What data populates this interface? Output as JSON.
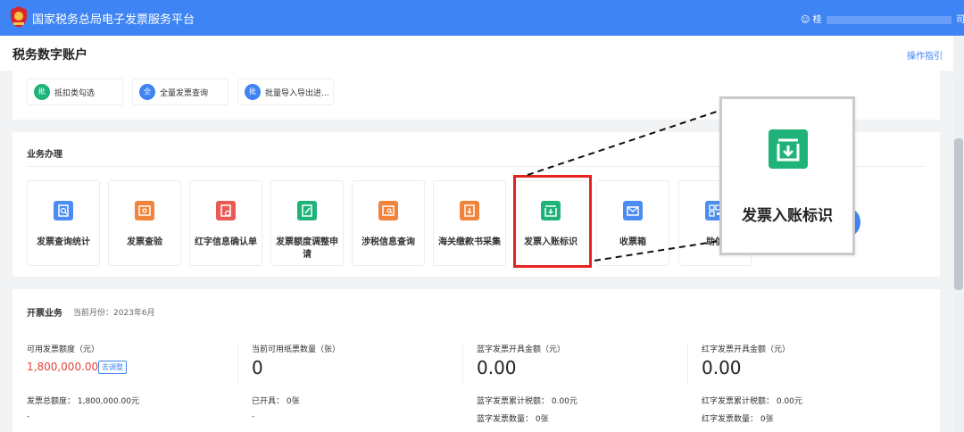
{
  "header": {
    "site_title": "国家税务总局电子发票服务平台",
    "user_prefix": "桂",
    "user_suffix": "司"
  },
  "subheader": {
    "page_title": "税务数字账户",
    "guide_link": "操作指引"
  },
  "quick_actions": [
    {
      "badge": "批",
      "label": "抵扣类勾选",
      "color": "#1fb37a"
    },
    {
      "badge": "全",
      "label": "全量发票查询",
      "color": "#3e84f4"
    },
    {
      "badge": "批",
      "label": "批量导入导出进...",
      "color": "#3e84f4"
    }
  ],
  "business": {
    "title": "业务办理",
    "tiles": [
      {
        "label": "发票查询统计",
        "icon": "invoice-search-icon",
        "color": "#4a8cf0"
      },
      {
        "label": "发票查验",
        "icon": "invoice-verify-icon",
        "color": "#f0843c"
      },
      {
        "label": "红字信息确认单",
        "icon": "red-letter-confirm-icon",
        "color": "#e85b55"
      },
      {
        "label": "发票额度调整申请",
        "icon": "quota-adjust-icon",
        "color": "#1fb37a"
      },
      {
        "label": "涉税信息查询",
        "icon": "tax-info-search-icon",
        "color": "#f0843c"
      },
      {
        "label": "海关缴款书采集",
        "icon": "customs-collect-icon",
        "color": "#f0843c"
      },
      {
        "label": "发票入账标识",
        "icon": "invoice-accounting-icon",
        "color": "#1fb37a"
      },
      {
        "label": "收票箱",
        "icon": "mailbox-icon",
        "color": "#4a8cf0"
      },
      {
        "label": "助信",
        "icon": "qr-code-icon",
        "color": "#4a8cf0"
      }
    ],
    "zoom_label": "发票入账标识"
  },
  "invoicing": {
    "title": "开票业务",
    "current_month": "当前月份：2023年6月",
    "col1": {
      "label": "可用发票额度（元）",
      "value": "1,800,000.00",
      "adjust": "去调整",
      "line1": "发票总额度：   1,800,000.00元",
      "line2": "-"
    },
    "col2": {
      "label": "当前可用纸票数量（张）",
      "value": "0",
      "line1": "已开具：   0张",
      "line2": "-"
    },
    "col3": {
      "label": "蓝字发票开具金额（元）",
      "value": "0.00",
      "line1": "蓝字发票累计税额：  0.00元",
      "line2": "蓝字发票数量：   0张"
    },
    "col4": {
      "label": "红字发票开具金额（元）",
      "value": "0.00",
      "line1": "红字发票累计税额：  0.00元",
      "line2": "红字发票数量：   0张"
    }
  },
  "colors": {
    "brand_blue": "#3e84f4",
    "highlight_red": "#e5231f",
    "amount_red": "#e5433d"
  }
}
